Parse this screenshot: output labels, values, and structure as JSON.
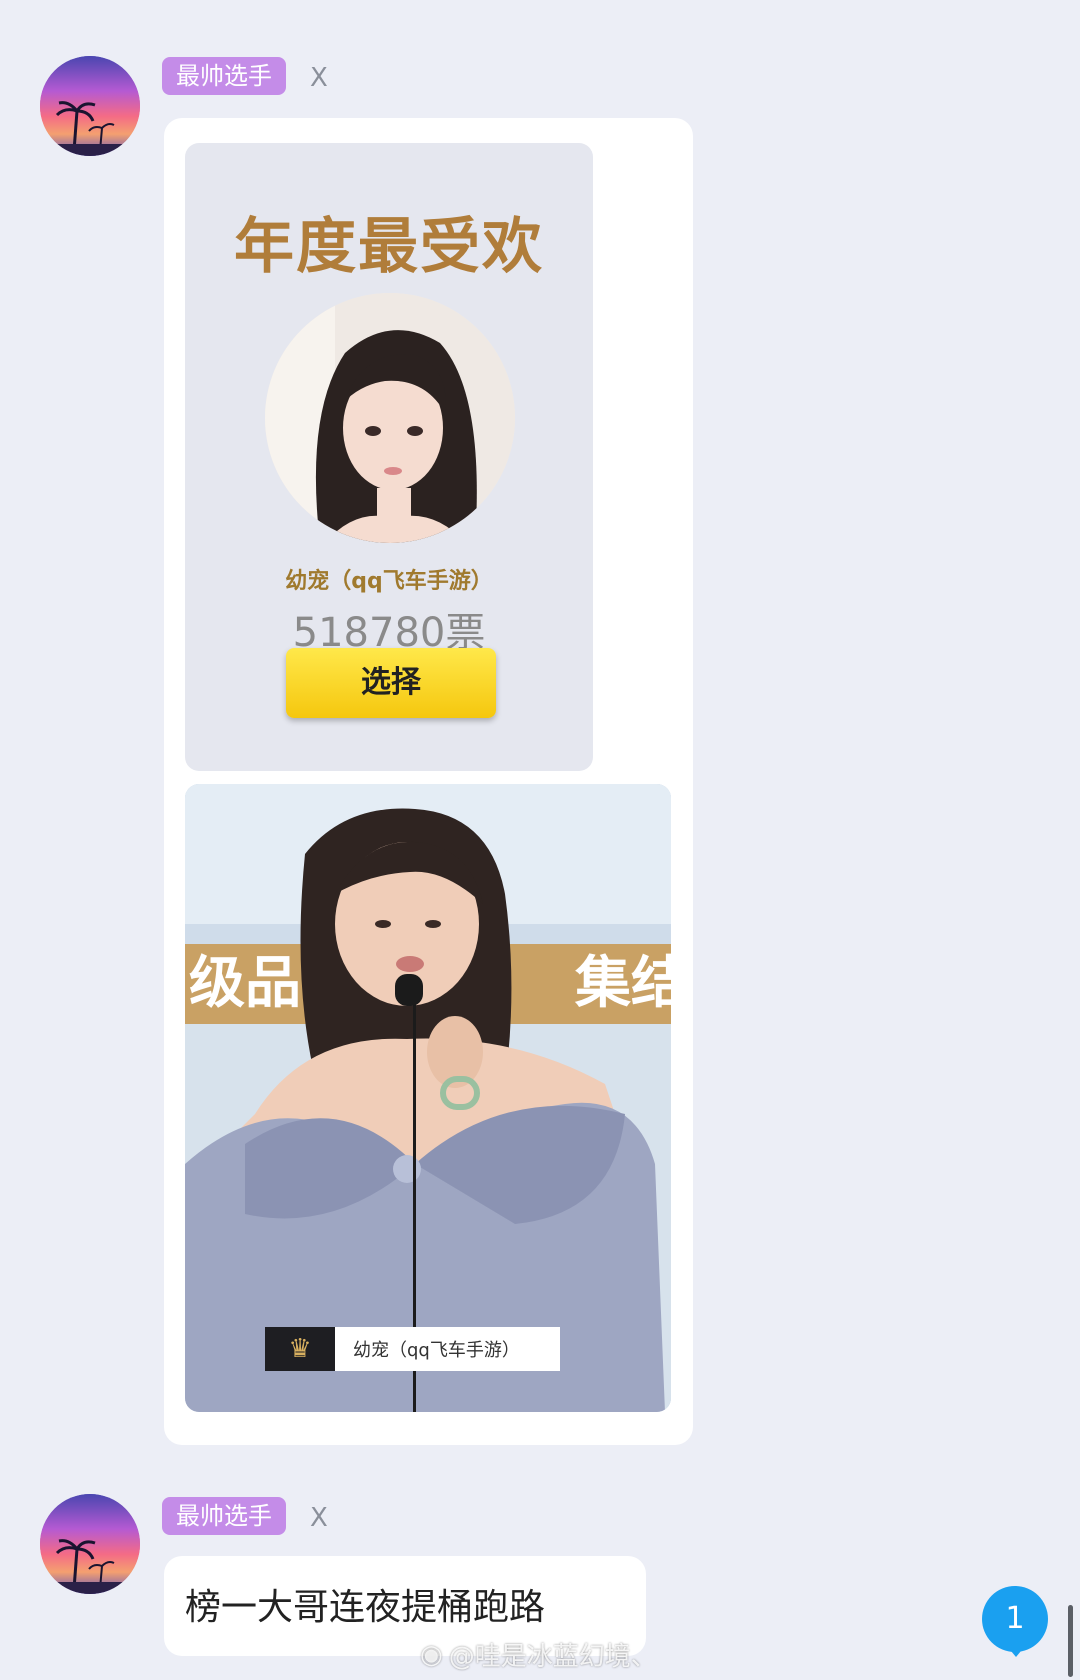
{
  "messages": [
    {
      "sender_tag": "最帅选手",
      "close": "X",
      "vote_card": {
        "banner": "年度最受欢",
        "name": "幼宠（qq飞车手游）",
        "votes": "518780票",
        "button": "选择"
      },
      "stage_photo": {
        "backdrop_text_left": "级品",
        "backdrop_text_right": "集结",
        "caption": "幼宠（qq飞车手游）"
      }
    },
    {
      "sender_tag": "最帅选手",
      "close": "X",
      "text": "榜一大哥连夜提桶跑路"
    }
  ],
  "unread_badge": "1",
  "watermark": "@哇是冰蓝幻境、",
  "colors": {
    "background": "#eceef6",
    "tag": "#c48ce8",
    "badge": "#1aa0f0",
    "vote_button": "#f5c70e"
  }
}
